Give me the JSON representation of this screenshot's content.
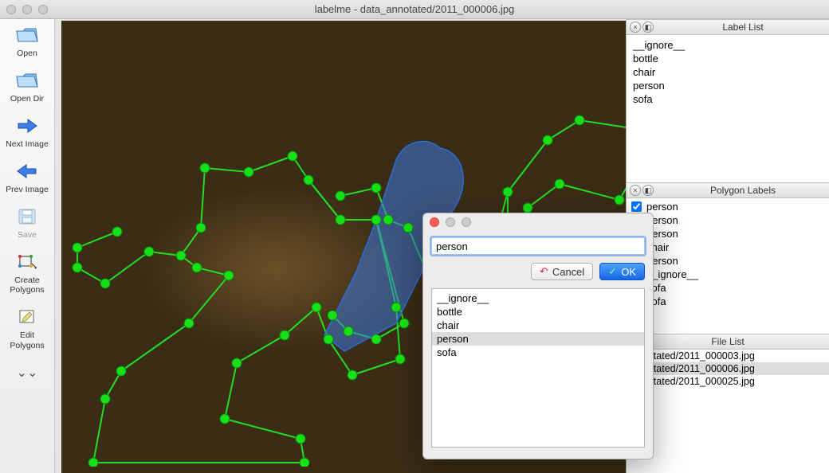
{
  "window": {
    "title": "labelme - data_annotated/2011_000006.jpg"
  },
  "toolbar": {
    "open": "Open",
    "open_dir": "Open Dir",
    "next": "Next Image",
    "prev": "Prev Image",
    "save": "Save",
    "create": "Create\nPolygons",
    "edit": "Edit\nPolygons"
  },
  "panels": {
    "label_list_title": "Label List",
    "polygon_labels_title": "Polygon Labels",
    "file_list_title": "File List"
  },
  "label_list": [
    "__ignore__",
    "bottle",
    "chair",
    "person",
    "sofa"
  ],
  "polygon_labels": [
    {
      "checked": true,
      "text": "person"
    },
    {
      "checked": true,
      "text": "person"
    },
    {
      "checked": false,
      "text": "person"
    },
    {
      "checked": false,
      "text": "chair"
    },
    {
      "checked": false,
      "text": "person"
    },
    {
      "checked": false,
      "text": "__ignore__"
    },
    {
      "checked": false,
      "text": "sofa"
    },
    {
      "checked": false,
      "text": "sofa"
    }
  ],
  "file_list": [
    {
      "text": "annotated/2011_000003.jpg",
      "selected": false
    },
    {
      "text": "annotated/2011_000006.jpg",
      "selected": true
    },
    {
      "text": "annotated/2011_000025.jpg",
      "selected": false
    }
  ],
  "dialog": {
    "input_value": "person",
    "cancel": "Cancel",
    "ok": "OK",
    "options": [
      "__ignore__",
      "bottle",
      "chair",
      "person",
      "sofa"
    ],
    "highlighted": "person"
  },
  "colors": {
    "polygon_stroke": "#22dd22",
    "vertex": "#18e018",
    "selected_fill": "rgba(60,120,220,0.55)"
  }
}
